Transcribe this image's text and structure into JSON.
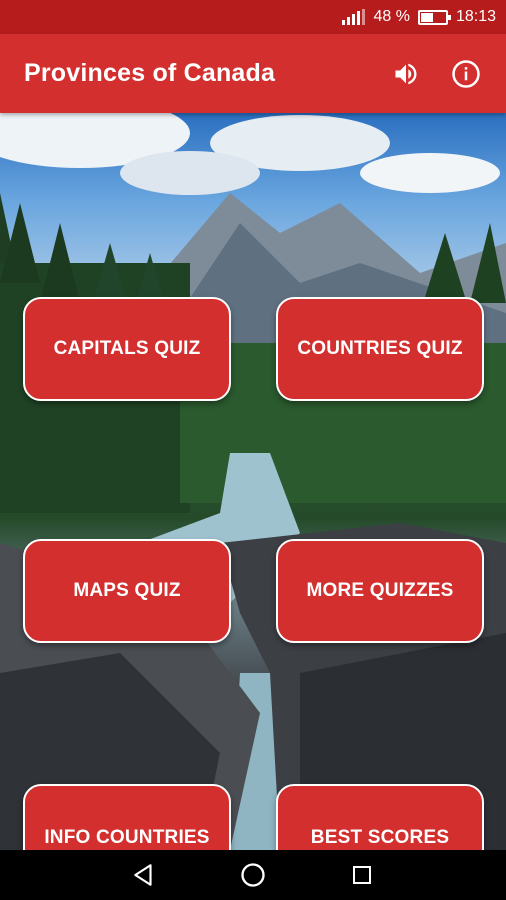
{
  "status_bar": {
    "battery_text": "48 %",
    "time": "18:13",
    "battery_level": 0.48
  },
  "app_bar": {
    "title": "Provinces of Canada",
    "icons": [
      "volume-icon",
      "info-icon"
    ]
  },
  "menu": {
    "buttons": [
      {
        "label": "CAPITALS QUIZ"
      },
      {
        "label": "COUNTRIES QUIZ"
      },
      {
        "label": "MAPS QUIZ"
      },
      {
        "label": "MORE QUIZZES"
      },
      {
        "label": "INFO COUNTRIES"
      },
      {
        "label": "BEST SCORES"
      }
    ]
  },
  "nav_bar": {
    "icons": [
      "back-icon",
      "home-icon",
      "recents-icon"
    ]
  },
  "colors": {
    "status_bar": "#b71c1c",
    "app_bar": "#d32f2f",
    "button": "#d32f2f",
    "button_border": "#ffffff"
  }
}
